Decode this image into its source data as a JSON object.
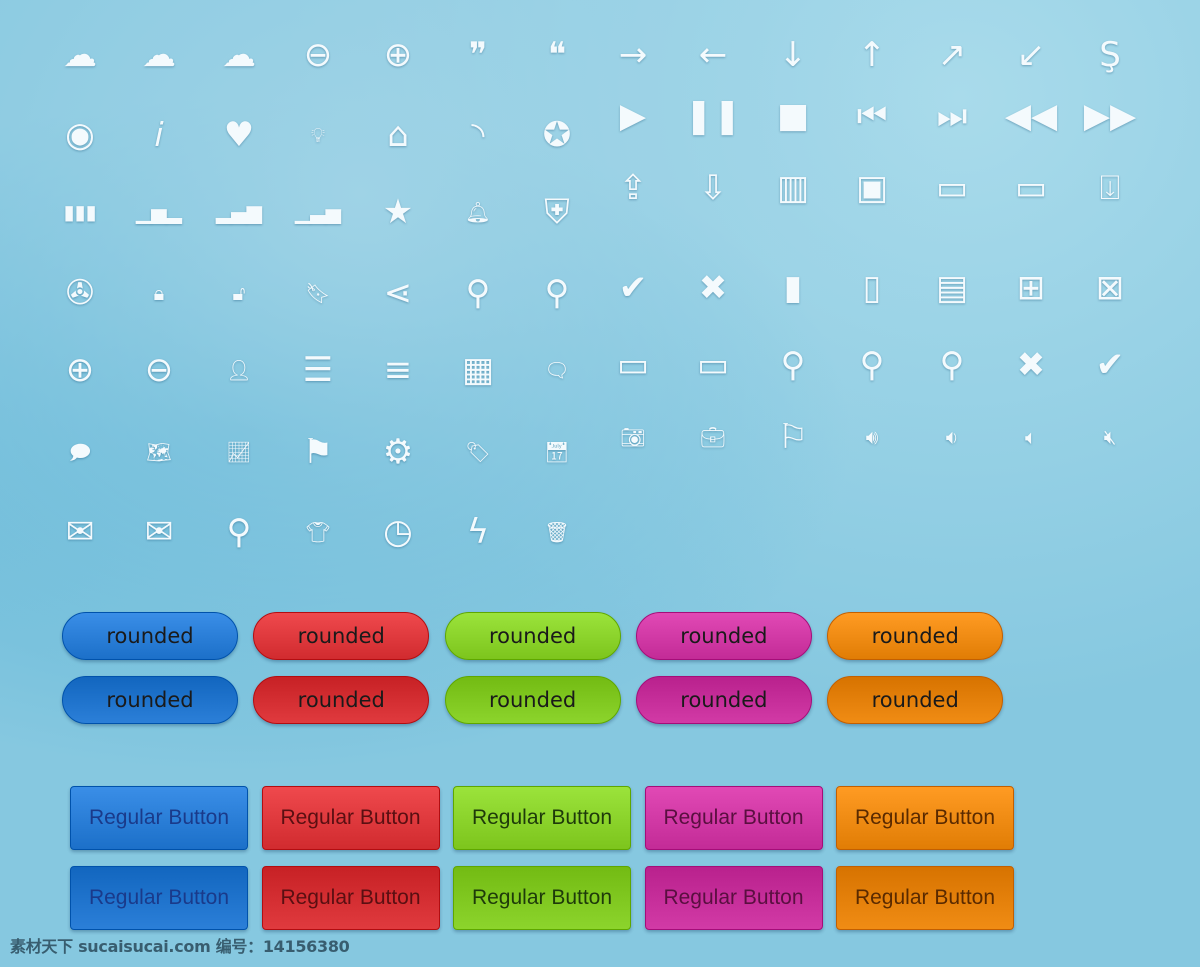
{
  "icons_left": [
    [
      "cloud",
      "cloud-upload",
      "cloud-download",
      "minus-circle",
      "plus-circle",
      "quote-close",
      "quote-open"
    ],
    [
      "eye",
      "info",
      "heart",
      "lightbulb",
      "home",
      "rss",
      "award"
    ],
    [
      "bar-chart",
      "bar-chart-baseline",
      "signal-bars",
      "signal-bars-baseline",
      "star",
      "bell",
      "shield"
    ],
    [
      "film-reel",
      "lock",
      "unlock",
      "bookmark",
      "share",
      "map-pin",
      "location-pin"
    ],
    [
      "pin-add",
      "pin-remove",
      "user",
      "list",
      "menu",
      "grid",
      "speech-bubble"
    ],
    [
      "comment",
      "map",
      "trend-chart",
      "signpost",
      "gear",
      "tag",
      "calendar"
    ],
    [
      "envelope",
      "envelope-open",
      "magic-wand",
      "t-shirt",
      "clock",
      "lightning",
      "trash"
    ]
  ],
  "icons_right": [
    [
      "arrow-right",
      "arrow-left",
      "arrow-down",
      "arrow-up",
      "arrow-up-right",
      "arrow-down-left",
      "skype-s"
    ],
    [
      "play",
      "pause",
      "stop",
      "skip-back",
      "skip-forward",
      "rewind",
      "fast-forward"
    ],
    [
      "file-upload",
      "file-download",
      "notebook",
      "rss-square",
      "presentation",
      "monitor",
      "monitor-download"
    ],
    [
      "check-circle",
      "x-circle",
      "document-filled",
      "document",
      "document-text",
      "document-add",
      "document-remove"
    ],
    [
      "battery-full",
      "battery-half",
      "search",
      "zoom-out",
      "zoom-in",
      "close",
      "check"
    ],
    [
      "camera",
      "briefcase",
      "flag",
      "volume-high",
      "volume-medium",
      "volume-low",
      "volume-mute"
    ]
  ],
  "rounded_label": "rounded",
  "regular_label": "Regular Button",
  "colors": [
    "#2b7fd8",
    "#e03a3e",
    "#8cd42c",
    "#d23aa6",
    "#f08c14"
  ],
  "text_colors_regular": [
    "#1a3a8a",
    "#5a0f12",
    "#1e3a0a",
    "#5a0f40",
    "#5a2a00"
  ],
  "watermark": "素材天下 sucaisucai.com  编号：14156380"
}
